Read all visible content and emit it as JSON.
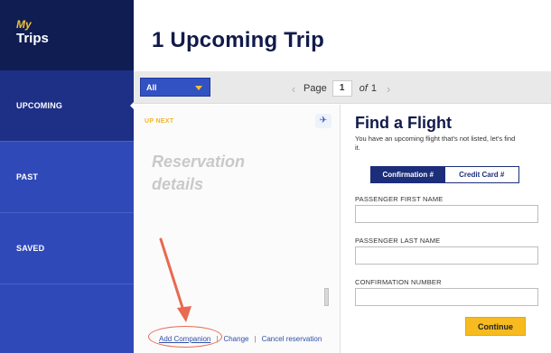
{
  "brand": {
    "my": "My",
    "trips": "Trips"
  },
  "sidebar": {
    "items": [
      {
        "label": "UPCOMING",
        "active": true
      },
      {
        "label": "PAST",
        "active": false
      },
      {
        "label": "SAVED",
        "active": false
      }
    ]
  },
  "header": {
    "title": "1 Upcoming Trip"
  },
  "toolbar": {
    "filter_value": "All",
    "page_label": "Page",
    "page_current": "1",
    "page_of": "of",
    "page_total": "1"
  },
  "reservation": {
    "up_next": "UP NEXT",
    "title": "Reservation details",
    "links": {
      "add_companion": "Add Companion",
      "change": "Change",
      "cancel": "Cancel reservation",
      "separator": "|"
    }
  },
  "find_flight": {
    "title": "Find a Flight",
    "subtitle": "You have an upcoming flight that's not listed, let's find it.",
    "tabs": {
      "confirmation": "Confirmation #",
      "credit_card": "Credit Card #"
    },
    "fields": {
      "first_name": "PASSENGER FIRST NAME",
      "last_name": "PASSENGER LAST NAME",
      "confirmation": "CONFIRMATION NUMBER"
    },
    "continue": "Continue"
  },
  "colors": {
    "navy": "#0f1d52",
    "sidebar_blue": "#3049b8",
    "accent_yellow": "#f7bb20",
    "annotation_red": "#e86a52"
  },
  "icons": {
    "plane": "airplane-icon",
    "prev": "chevron-left-icon",
    "next": "chevron-right-icon",
    "caret": "caret-down-icon"
  }
}
